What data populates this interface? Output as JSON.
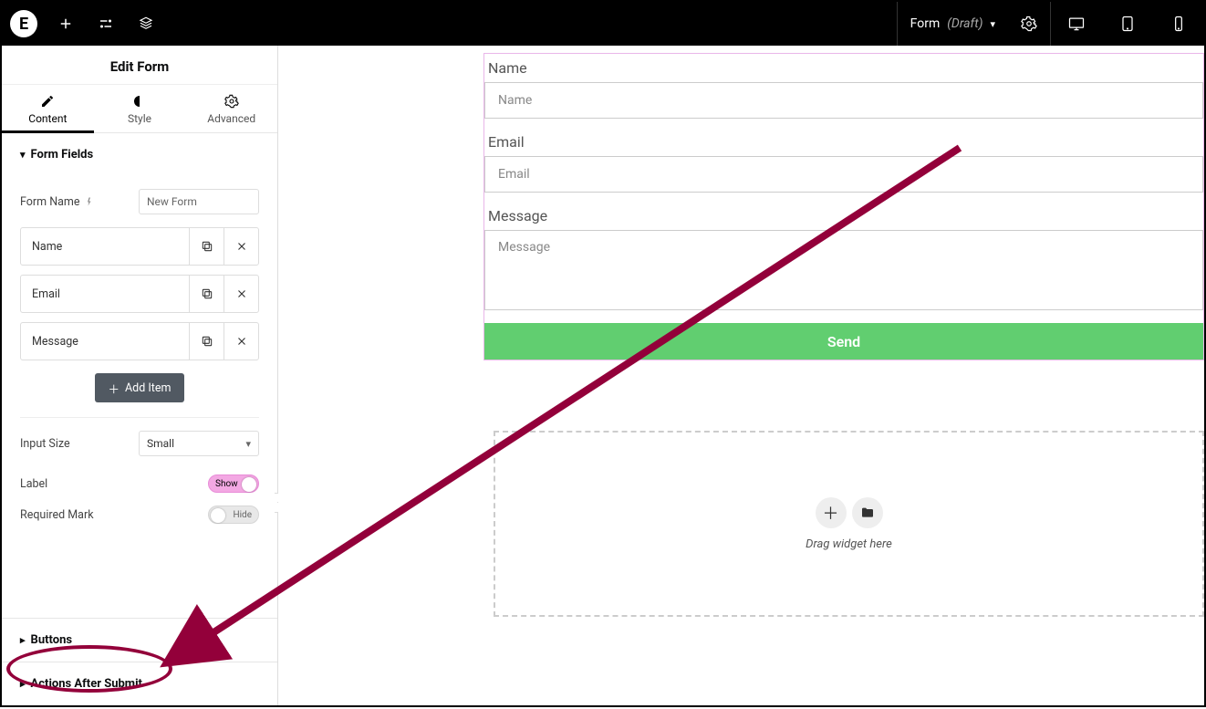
{
  "topbar": {
    "doc_name": "Form",
    "doc_status": "(Draft)"
  },
  "panel": {
    "title": "Edit Form",
    "tabs": {
      "content": "Content",
      "style": "Style",
      "advanced": "Advanced"
    }
  },
  "sections": {
    "form_fields": "Form Fields",
    "buttons": "Buttons",
    "actions": "Actions After Submit"
  },
  "controls": {
    "form_name_label": "Form Name",
    "form_name_value": "New Form",
    "add_item": "Add Item",
    "input_size_label": "Input Size",
    "input_size_value": "Small",
    "label_label": "Label",
    "label_toggle": "Show",
    "required_label": "Required Mark",
    "required_toggle": "Hide"
  },
  "fields": [
    {
      "name": "Name"
    },
    {
      "name": "Email"
    },
    {
      "name": "Message"
    }
  ],
  "preview": {
    "name_label": "Name",
    "name_ph": "Name",
    "email_label": "Email",
    "email_ph": "Email",
    "message_label": "Message",
    "message_ph": "Message",
    "send": "Send"
  },
  "dropzone": {
    "text": "Drag widget here"
  }
}
